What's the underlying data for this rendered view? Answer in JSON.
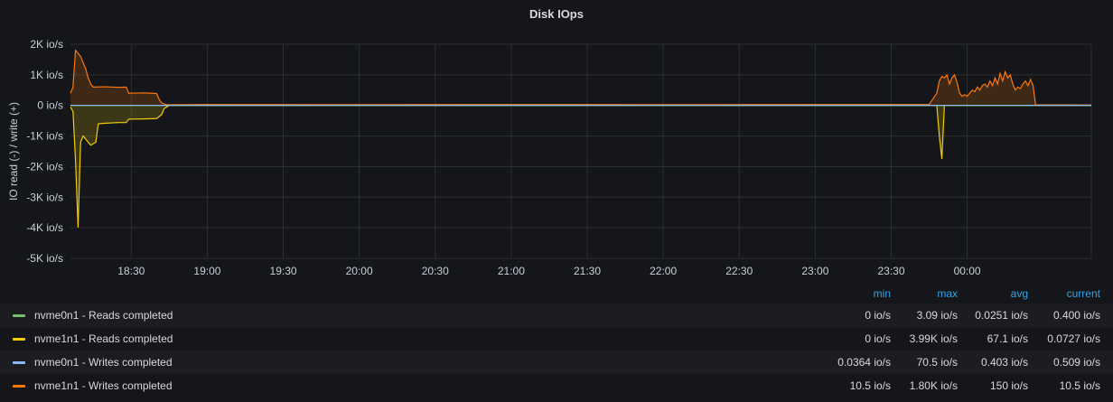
{
  "panel": {
    "title": "Disk IOps"
  },
  "legend": {
    "headers": {
      "min": "min",
      "max": "max",
      "avg": "avg",
      "current": "current"
    },
    "rows": [
      {
        "name": "nvme0n1 - Reads completed",
        "color": "#73bf69",
        "min": "0 io/s",
        "max": "3.09 io/s",
        "avg": "0.0251 io/s",
        "current": "0.400 io/s"
      },
      {
        "name": "nvme1n1 - Reads completed",
        "color": "#f2cc0c",
        "min": "0 io/s",
        "max": "3.99K io/s",
        "avg": "67.1 io/s",
        "current": "0.0727 io/s"
      },
      {
        "name": "nvme0n1 - Writes completed",
        "color": "#8ab8ff",
        "min": "0.0364 io/s",
        "max": "70.5 io/s",
        "avg": "0.403 io/s",
        "current": "0.509 io/s"
      },
      {
        "name": "nvme1n1 - Writes completed",
        "color": "#ff780a",
        "min": "10.5 io/s",
        "max": "1.80K io/s",
        "avg": "150 io/s",
        "current": "10.5 io/s"
      }
    ]
  },
  "chart_data": {
    "type": "area",
    "title": "Disk IOps",
    "ylabel": "IO read (-) / write (+)",
    "xlabel": "",
    "ylim": [
      -5000,
      2000
    ],
    "yticks": [
      2000,
      1000,
      0,
      -1000,
      -2000,
      -3000,
      -4000,
      -5000
    ],
    "ytick_labels": [
      "2K io/s",
      "1K io/s",
      "0 io/s",
      "-1K io/s",
      "-2K io/s",
      "-3K io/s",
      "-4K io/s",
      "-5K io/s"
    ],
    "xlim": [
      "18:06",
      "00:49"
    ],
    "xtick_labels": [
      "18:30",
      "19:00",
      "19:30",
      "20:00",
      "20:30",
      "21:00",
      "21:30",
      "22:00",
      "22:30",
      "23:00",
      "23:30",
      "00:00"
    ],
    "grid": true,
    "legend": "bottom",
    "series": [
      {
        "name": "nvme0n1 - Reads completed",
        "color": "#73bf69",
        "mirrored": true,
        "points": [
          [
            "18:06",
            0
          ],
          [
            "00:49",
            0
          ]
        ]
      },
      {
        "name": "nvme1n1 - Reads completed",
        "color": "#f2cc0c",
        "mirrored": true,
        "points": [
          [
            "18:06",
            -50
          ],
          [
            "18:07",
            -200
          ],
          [
            "18:08",
            -1800
          ],
          [
            "18:09",
            -3990
          ],
          [
            "18:10",
            -1200
          ],
          [
            "18:11",
            -1000
          ],
          [
            "18:12",
            -1100
          ],
          [
            "18:13",
            -1200
          ],
          [
            "18:14",
            -1300
          ],
          [
            "18:16",
            -1200
          ],
          [
            "18:17",
            -600
          ],
          [
            "18:20",
            -580
          ],
          [
            "18:25",
            -560
          ],
          [
            "18:28",
            -560
          ],
          [
            "18:29",
            -450
          ],
          [
            "18:35",
            -440
          ],
          [
            "18:40",
            -430
          ],
          [
            "18:42",
            -300
          ],
          [
            "18:43",
            -100
          ],
          [
            "18:45",
            0
          ],
          [
            "23:48",
            0
          ],
          [
            "23:49",
            -1000
          ],
          [
            "23:50",
            -1750
          ],
          [
            "23:51",
            0
          ],
          [
            "00:49",
            0
          ]
        ]
      },
      {
        "name": "nvme0n1 - Writes completed",
        "color": "#8ab8ff",
        "mirrored": false,
        "points": [
          [
            "18:06",
            5
          ],
          [
            "00:49",
            5
          ]
        ]
      },
      {
        "name": "nvme1n1 - Writes completed",
        "color": "#ff780a",
        "mirrored": false,
        "points": [
          [
            "18:06",
            400
          ],
          [
            "18:07",
            600
          ],
          [
            "18:08",
            1800
          ],
          [
            "18:09",
            1700
          ],
          [
            "18:10",
            1600
          ],
          [
            "18:11",
            1400
          ],
          [
            "18:12",
            1200
          ],
          [
            "18:13",
            900
          ],
          [
            "18:14",
            700
          ],
          [
            "18:15",
            600
          ],
          [
            "18:20",
            610
          ],
          [
            "18:25",
            590
          ],
          [
            "18:28",
            600
          ],
          [
            "18:29",
            400
          ],
          [
            "18:35",
            410
          ],
          [
            "18:40",
            390
          ],
          [
            "18:41",
            200
          ],
          [
            "18:42",
            80
          ],
          [
            "18:44",
            20
          ],
          [
            "19:00",
            30
          ],
          [
            "20:00",
            25
          ],
          [
            "21:00",
            30
          ],
          [
            "22:00",
            25
          ],
          [
            "23:00",
            30
          ],
          [
            "23:45",
            30
          ],
          [
            "23:48",
            400
          ],
          [
            "23:49",
            800
          ],
          [
            "23:50",
            950
          ],
          [
            "23:51",
            900
          ],
          [
            "23:52",
            1000
          ],
          [
            "23:53",
            700
          ],
          [
            "23:54",
            900
          ],
          [
            "23:55",
            1000
          ],
          [
            "23:56",
            750
          ],
          [
            "23:57",
            400
          ],
          [
            "23:58",
            300
          ],
          [
            "23:59",
            350
          ],
          [
            "00:00",
            300
          ],
          [
            "00:01",
            400
          ],
          [
            "00:02",
            500
          ],
          [
            "00:03",
            450
          ],
          [
            "00:04",
            600
          ],
          [
            "00:05",
            500
          ],
          [
            "00:06",
            650
          ],
          [
            "00:07",
            700
          ],
          [
            "00:08",
            600
          ],
          [
            "00:09",
            800
          ],
          [
            "00:10",
            650
          ],
          [
            "00:11",
            900
          ],
          [
            "00:12",
            700
          ],
          [
            "00:13",
            1050
          ],
          [
            "00:14",
            800
          ],
          [
            "00:15",
            1100
          ],
          [
            "00:16",
            900
          ],
          [
            "00:17",
            1000
          ],
          [
            "00:18",
            700
          ],
          [
            "00:19",
            500
          ],
          [
            "00:20",
            600
          ],
          [
            "00:21",
            550
          ],
          [
            "00:22",
            700
          ],
          [
            "00:23",
            800
          ],
          [
            "00:24",
            650
          ],
          [
            "00:25",
            850
          ],
          [
            "00:26",
            650
          ],
          [
            "00:27",
            20
          ],
          [
            "00:49",
            15
          ]
        ]
      }
    ]
  }
}
